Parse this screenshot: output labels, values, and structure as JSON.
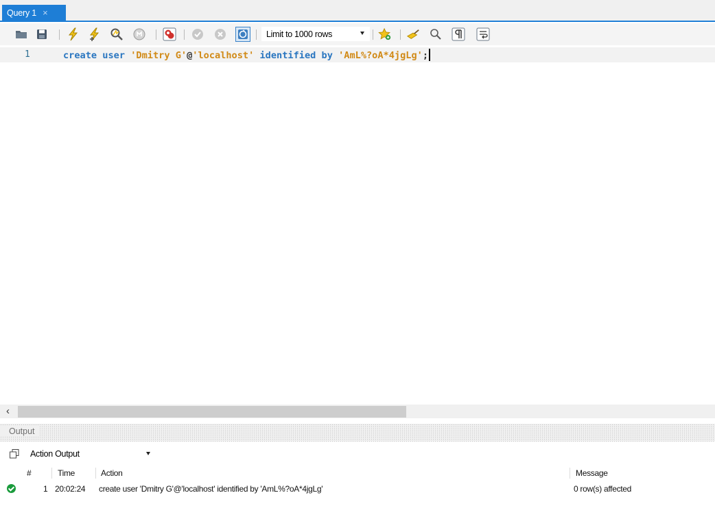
{
  "tab": {
    "title": "Query 1",
    "close_glyph": "×"
  },
  "toolbar": {
    "icons": [
      "open-file-icon",
      "save-icon",
      "execute-icon",
      "execute-current-icon",
      "explain-icon",
      "stop-icon",
      "toggle-error-icon",
      "commit-icon",
      "rollback-icon",
      "autocommit-icon",
      "add-snippet-icon",
      "beautify-icon",
      "find-icon",
      "invisible-chars-icon",
      "word-wrap-icon"
    ],
    "limit_label": "Limit to 1000 rows"
  },
  "editor": {
    "line_number": "1",
    "tokens": {
      "create": "create",
      "user": "user",
      "username": "'Dmitry G'",
      "at": "@",
      "host": "'localhost'",
      "identified": "identified",
      "by": "by",
      "password": "'AmL%?oA*4jgLg'",
      "semicolon": ";"
    }
  },
  "output": {
    "title": "Output",
    "selector": "Action Output",
    "columns": {
      "num": "#",
      "time": "Time",
      "action": "Action",
      "message": "Message"
    },
    "rows": [
      {
        "status": "success",
        "num": "1",
        "time": "20:02:24",
        "action": "create user 'Dmitry G'@'localhost' identified by 'AmL%?oA*4jgLg'",
        "message": "0 row(s) affected"
      }
    ]
  },
  "colors": {
    "accent": "#1e7ed6",
    "keyword": "#2a76c0",
    "string": "#d18a17",
    "success": "#1a9b3c"
  }
}
